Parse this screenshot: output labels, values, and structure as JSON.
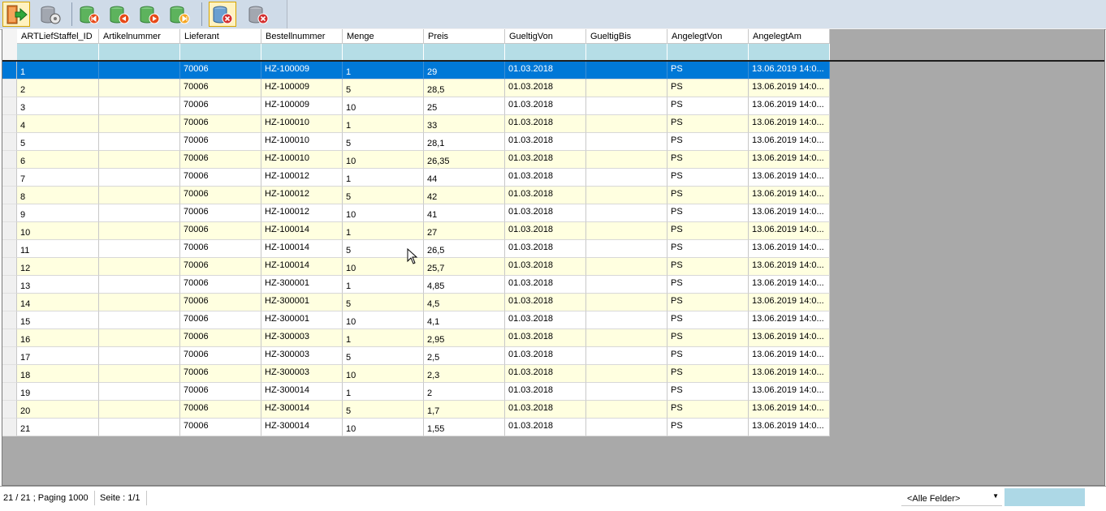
{
  "toolbar": {
    "buttons": [
      {
        "name": "exit-button",
        "icon": "exit-door-icon",
        "active": true
      },
      {
        "name": "database-settings-button",
        "icon": "database-gear-icon"
      },
      {
        "name": "first-record-button",
        "icon": "database-first-icon"
      },
      {
        "name": "previous-record-button",
        "icon": "database-previous-icon"
      },
      {
        "name": "next-record-button",
        "icon": "database-next-icon"
      },
      {
        "name": "last-record-button",
        "icon": "database-last-icon"
      },
      {
        "name": "delete-record-button",
        "icon": "database-delete-icon",
        "active": true
      },
      {
        "name": "cancel-button",
        "icon": "database-cancel-icon"
      }
    ]
  },
  "grid": {
    "columns": [
      "ARTLiefStaffel_ID",
      "Artikelnummer",
      "Lieferant",
      "Bestellnummer",
      "Menge",
      "Preis",
      "GueltigVon",
      "GueltigBis",
      "AngelegtVon",
      "AngelegtAm"
    ],
    "selected_row": 0,
    "rows": [
      [
        "1",
        "",
        "70006",
        "HZ-100009",
        "1",
        "29",
        "01.03.2018",
        "",
        "PS",
        "13.06.2019 14:0..."
      ],
      [
        "2",
        "",
        "70006",
        "HZ-100009",
        "5",
        "28,5",
        "01.03.2018",
        "",
        "PS",
        "13.06.2019 14:0..."
      ],
      [
        "3",
        "",
        "70006",
        "HZ-100009",
        "10",
        "25",
        "01.03.2018",
        "",
        "PS",
        "13.06.2019 14:0..."
      ],
      [
        "4",
        "",
        "70006",
        "HZ-100010",
        "1",
        "33",
        "01.03.2018",
        "",
        "PS",
        "13.06.2019 14:0..."
      ],
      [
        "5",
        "",
        "70006",
        "HZ-100010",
        "5",
        "28,1",
        "01.03.2018",
        "",
        "PS",
        "13.06.2019 14:0..."
      ],
      [
        "6",
        "",
        "70006",
        "HZ-100010",
        "10",
        "26,35",
        "01.03.2018",
        "",
        "PS",
        "13.06.2019 14:0..."
      ],
      [
        "7",
        "",
        "70006",
        "HZ-100012",
        "1",
        "44",
        "01.03.2018",
        "",
        "PS",
        "13.06.2019 14:0..."
      ],
      [
        "8",
        "",
        "70006",
        "HZ-100012",
        "5",
        "42",
        "01.03.2018",
        "",
        "PS",
        "13.06.2019 14:0..."
      ],
      [
        "9",
        "",
        "70006",
        "HZ-100012",
        "10",
        "41",
        "01.03.2018",
        "",
        "PS",
        "13.06.2019 14:0..."
      ],
      [
        "10",
        "",
        "70006",
        "HZ-100014",
        "1",
        "27",
        "01.03.2018",
        "",
        "PS",
        "13.06.2019 14:0..."
      ],
      [
        "11",
        "",
        "70006",
        "HZ-100014",
        "5",
        "26,5",
        "01.03.2018",
        "",
        "PS",
        "13.06.2019 14:0..."
      ],
      [
        "12",
        "",
        "70006",
        "HZ-100014",
        "10",
        "25,7",
        "01.03.2018",
        "",
        "PS",
        "13.06.2019 14:0..."
      ],
      [
        "13",
        "",
        "70006",
        "HZ-300001",
        "1",
        "4,85",
        "01.03.2018",
        "",
        "PS",
        "13.06.2019 14:0..."
      ],
      [
        "14",
        "",
        "70006",
        "HZ-300001",
        "5",
        "4,5",
        "01.03.2018",
        "",
        "PS",
        "13.06.2019 14:0..."
      ],
      [
        "15",
        "",
        "70006",
        "HZ-300001",
        "10",
        "4,1",
        "01.03.2018",
        "",
        "PS",
        "13.06.2019 14:0..."
      ],
      [
        "16",
        "",
        "70006",
        "HZ-300003",
        "1",
        "2,95",
        "01.03.2018",
        "",
        "PS",
        "13.06.2019 14:0..."
      ],
      [
        "17",
        "",
        "70006",
        "HZ-300003",
        "5",
        "2,5",
        "01.03.2018",
        "",
        "PS",
        "13.06.2019 14:0..."
      ],
      [
        "18",
        "",
        "70006",
        "HZ-300003",
        "10",
        "2,3",
        "01.03.2018",
        "",
        "PS",
        "13.06.2019 14:0..."
      ],
      [
        "19",
        "",
        "70006",
        "HZ-300014",
        "1",
        "2",
        "01.03.2018",
        "",
        "PS",
        "13.06.2019 14:0..."
      ],
      [
        "20",
        "",
        "70006",
        "HZ-300014",
        "5",
        "1,7",
        "01.03.2018",
        "",
        "PS",
        "13.06.2019 14:0..."
      ],
      [
        "21",
        "",
        "70006",
        "HZ-300014",
        "10",
        "1,55",
        "01.03.2018",
        "",
        "PS",
        "13.06.2019 14:0..."
      ]
    ]
  },
  "status": {
    "record_info": "21 / 21 ; Paging 1000",
    "page_info": "Seite : 1/1",
    "field_select": "<Alle Felder>",
    "search_value": ""
  },
  "colors": {
    "selection": "#0078d7",
    "alt_row": "#ffffe0",
    "filter_row": "#b5dde6",
    "toolbar": "#cfdbe8"
  }
}
